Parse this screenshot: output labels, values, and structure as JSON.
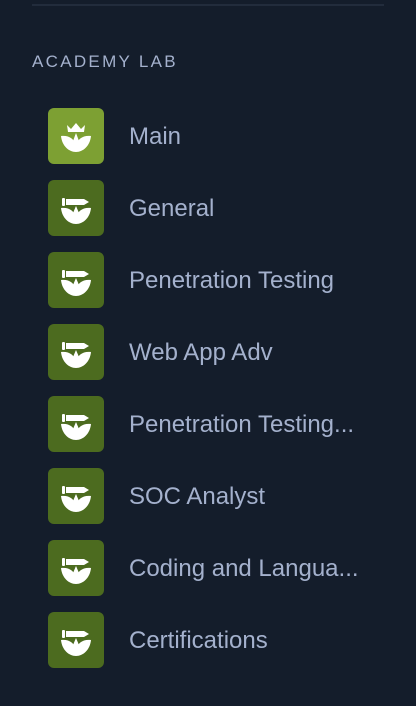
{
  "sidebar": {
    "section_title": "ACADEMY LAB",
    "items": [
      {
        "label": "Main",
        "icon": "crown-badge-icon",
        "color": "#7da033"
      },
      {
        "label": "General",
        "icon": "sword-badge-icon",
        "color": "#4c6b1f"
      },
      {
        "label": "Penetration Testing",
        "icon": "sword-badge-icon",
        "color": "#4c6b1f"
      },
      {
        "label": "Web App Adv",
        "icon": "sword-badge-icon",
        "color": "#4c6b1f"
      },
      {
        "label": "Penetration Testing...",
        "icon": "sword-badge-icon",
        "color": "#4c6b1f"
      },
      {
        "label": "SOC Analyst",
        "icon": "sword-badge-icon",
        "color": "#4c6b1f"
      },
      {
        "label": "Coding and Langua...",
        "icon": "sword-badge-icon",
        "color": "#4c6b1f"
      },
      {
        "label": "Certifications",
        "icon": "sword-badge-icon",
        "color": "#4c6b1f"
      }
    ]
  }
}
